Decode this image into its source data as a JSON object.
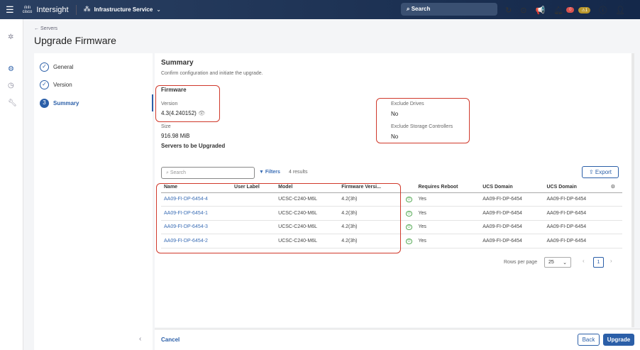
{
  "header": {
    "app": "Intersight",
    "logo": "cisco",
    "service": "Infrastructure Service",
    "search": "Search",
    "alerts_red": "0",
    "alerts_warn": "1"
  },
  "breadcrumb": "← Servers",
  "title": "Upgrade Firmware",
  "steps": [
    {
      "n": "✓",
      "label": "General"
    },
    {
      "n": "✓",
      "label": "Version"
    },
    {
      "n": "3",
      "label": "Summary"
    }
  ],
  "summary": {
    "heading": "Summary",
    "subtitle": "Confirm configuration and initiate the upgrade.",
    "firmware": "Firmware",
    "version_label": "Version",
    "version": "4.3(4.240152)",
    "size_label": "Size",
    "size": "916.98 MiB",
    "servers_heading": "Servers to be Upgraded",
    "exclude_drives_label": "Exclude Drives",
    "exclude_drives": "No",
    "exclude_storage_label": "Exclude Storage Controllers",
    "exclude_storage": "No"
  },
  "table": {
    "search_placeholder": "Search",
    "filters": "Filters",
    "results": "4 results",
    "export": "Export",
    "columns": [
      "Name",
      "User Label",
      "Model",
      "Firmware Versi...",
      "Requires Reboot",
      "UCS Domain",
      "UCS Domain"
    ],
    "rows": [
      [
        "AA09-FI-DP-6454-4",
        "",
        "UCSC-C240-M6L",
        "4.2(3h)",
        "Yes",
        "AA09-FI-DP-6454",
        "AA09-FI-DP-6454"
      ],
      [
        "AA09-FI-DP-6454-1",
        "",
        "UCSC-C240-M6L",
        "4.2(3h)",
        "Yes",
        "AA09-FI-DP-6454",
        "AA09-FI-DP-6454"
      ],
      [
        "AA09-FI-DP-6454-3",
        "",
        "UCSC-C240-M6L",
        "4.2(3h)",
        "Yes",
        "AA09-FI-DP-6454",
        "AA09-FI-DP-6454"
      ],
      [
        "AA09-FI-DP-6454-2",
        "",
        "UCSC-C240-M6L",
        "4.2(3h)",
        "Yes",
        "AA09-FI-DP-6454",
        "AA09-FI-DP-6454"
      ]
    ],
    "rows_per_page_label": "Rows per page",
    "rows_per_page": "25",
    "page": "1"
  },
  "footer": {
    "cancel": "Cancel",
    "back": "Back",
    "upgrade": "Upgrade"
  }
}
